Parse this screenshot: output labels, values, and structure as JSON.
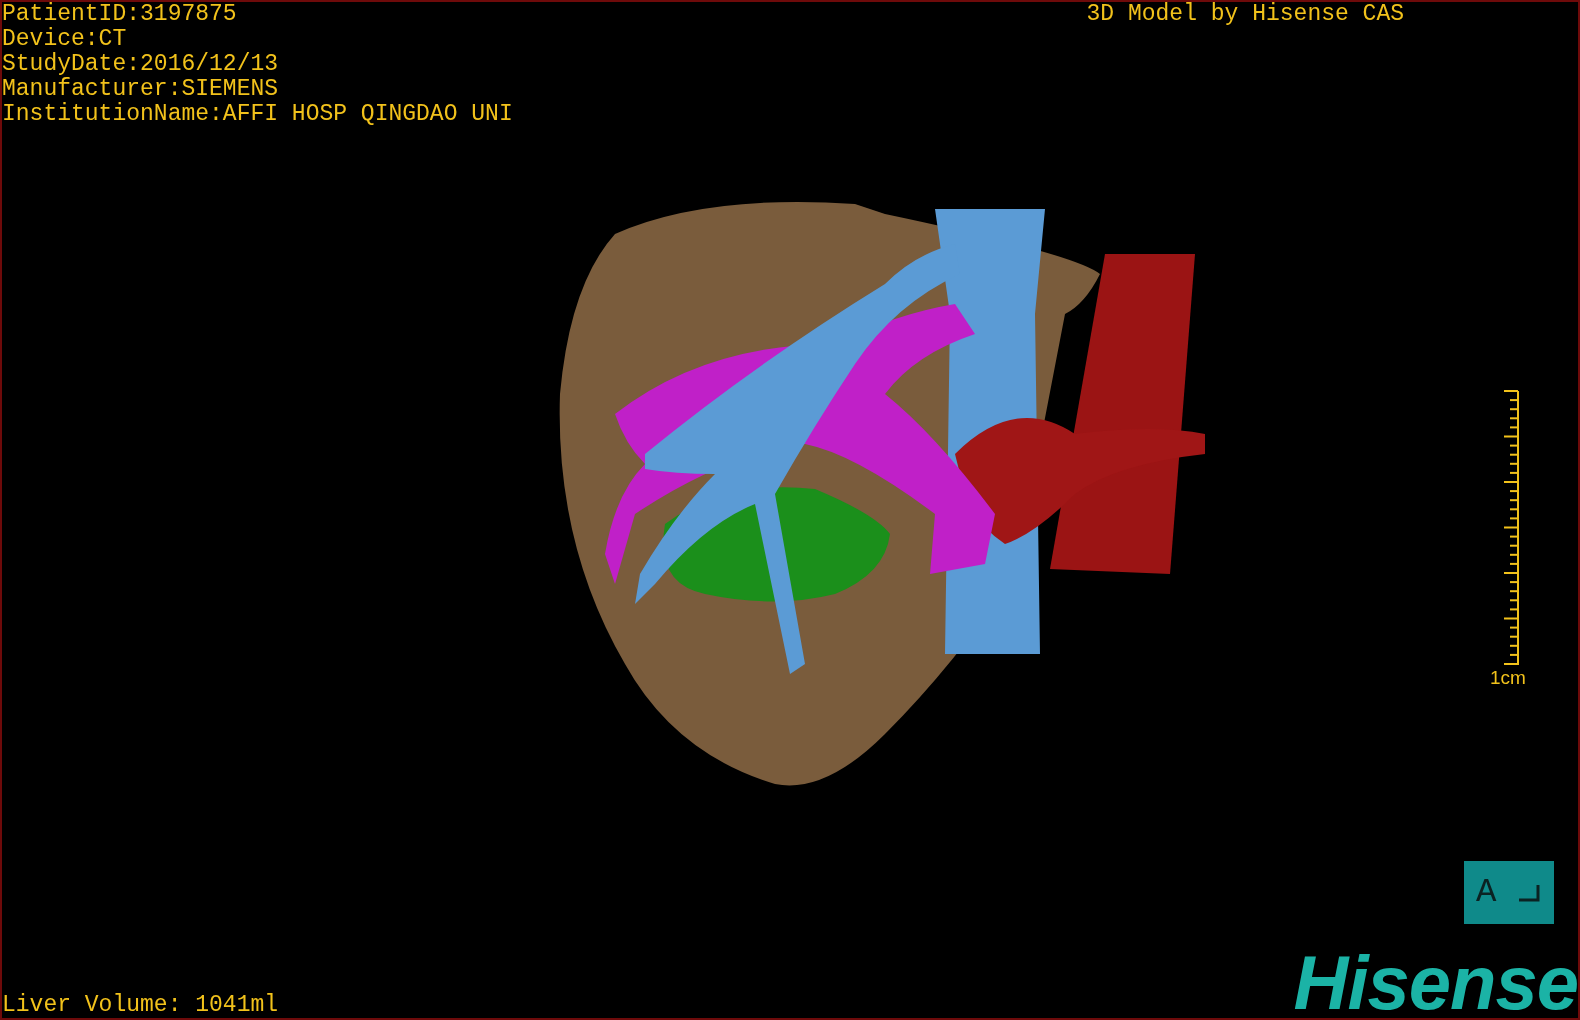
{
  "info_lines": [
    "PatientID:3197875",
    "Device:CT",
    "StudyDate:2016/12/13",
    "Manufacturer:SIEMENS",
    "InstitutionName:AFFI HOSP QINGDAO UNI"
  ],
  "title": "3D Model by Hisense CAS",
  "scale": {
    "label": "1cm"
  },
  "orientation": {
    "label": "A"
  },
  "logo": "Hisense",
  "volume": "Liver Volume: 1041ml"
}
